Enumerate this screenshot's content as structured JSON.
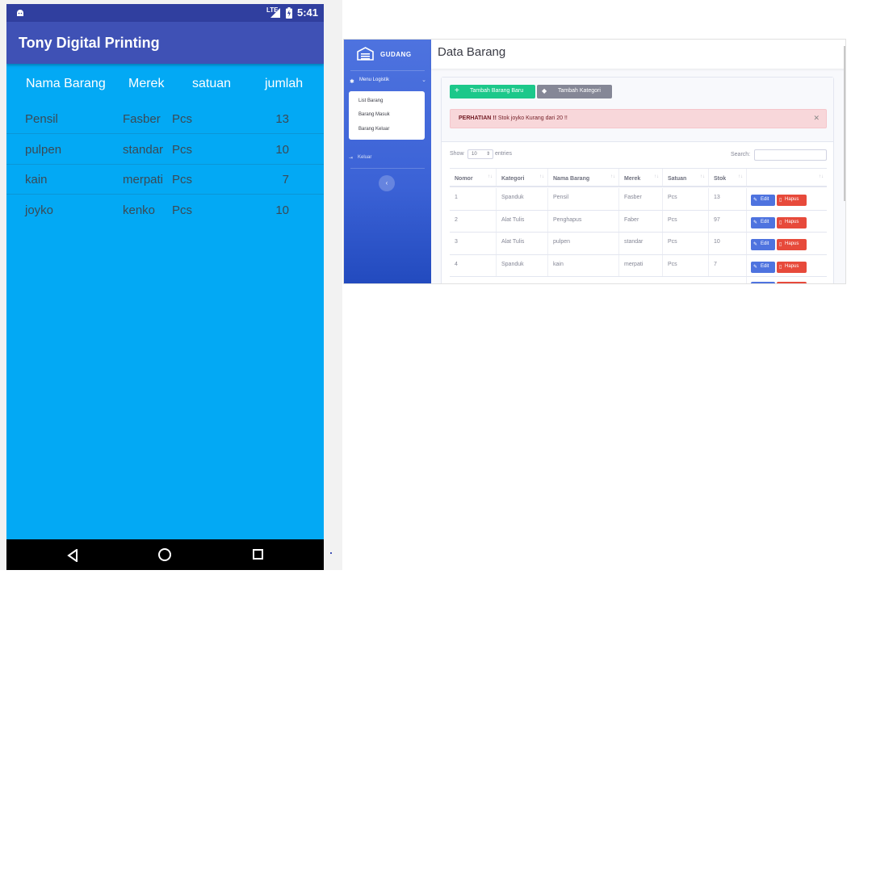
{
  "phone": {
    "status": {
      "network": "LTE",
      "time": "5:41"
    },
    "app_title": "Tony Digital Printing",
    "columns": [
      "Nama Barang",
      "Merek",
      "satuan",
      "jumlah"
    ],
    "rows": [
      [
        "Pensil",
        "Fasber",
        "Pcs",
        "13"
      ],
      [
        "pulpen",
        "standar",
        "Pcs",
        "10"
      ],
      [
        "kain",
        "merpati",
        "Pcs",
        "7"
      ],
      [
        "joyko",
        "kenko",
        "Pcs",
        "10"
      ]
    ],
    "nav": [
      "back-icon",
      "home-icon",
      "recent-apps-icon"
    ],
    "colors": {
      "status_bar": "#303f9f",
      "app_bar": "#3f51b5",
      "background": "#03a9f4"
    }
  },
  "web": {
    "brand": "GUDANG",
    "sidebar": {
      "menu_label": "Menu Logistik",
      "submenu": [
        "List Barang",
        "Barang Masuk",
        "Barang Keluar"
      ],
      "logout": "Keluar"
    },
    "page_title": "Data Barang",
    "buttons": {
      "add": "Tambah Barang Baru",
      "category": "Tambah Kategori"
    },
    "alert": {
      "strong": "PERHATIAN !!",
      "text": " Stok joyko Kurang dari 20 !!"
    },
    "table_controls": {
      "show": "Show",
      "entries_value": "10",
      "entries": "entries",
      "search": "Search:"
    },
    "table": {
      "columns": [
        "Nomor",
        "Kategori",
        "Nama Barang",
        "Merek",
        "Satuan",
        "Stok",
        ""
      ],
      "rows": [
        [
          "1",
          "Spanduk",
          "Pensil",
          "Fasber",
          "Pcs",
          "13"
        ],
        [
          "2",
          "Alat Tulis",
          "Penghapus",
          "Faber",
          "Pcs",
          "97"
        ],
        [
          "3",
          "Alat Tulis",
          "pulpen",
          "standar",
          "Pcs",
          "10"
        ],
        [
          "4",
          "Spanduk",
          "kain",
          "merpati",
          "Pcs",
          "7"
        ]
      ],
      "row_actions": {
        "edit": "Edit",
        "delete": "Hapus"
      }
    },
    "colors": {
      "sidebar": "#4e73df",
      "success": "#1cc88a",
      "secondary": "#858796",
      "danger": "#e74a3b",
      "primary": "#4e73df",
      "alert_bg": "#f8d7da"
    }
  }
}
